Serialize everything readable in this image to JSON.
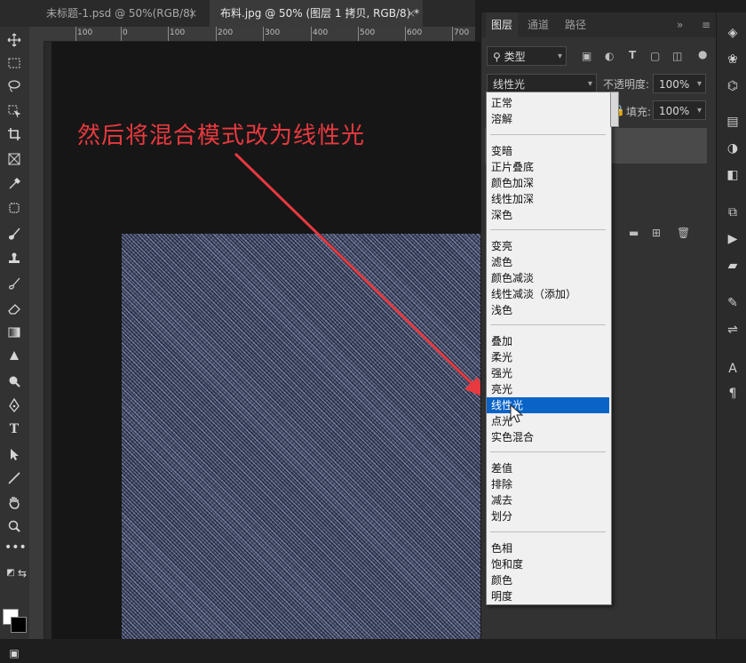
{
  "tabs": [
    {
      "label": "未标题-1.psd @ 50%(RGB/8)",
      "close": "×"
    },
    {
      "label": "布料.jpg @ 50% (图层 1 拷贝, RGB/8) *",
      "close": "×"
    }
  ],
  "ruler": {
    "ticks": [
      "100",
      "0",
      "100",
      "200",
      "300",
      "400",
      "500",
      "600",
      "700"
    ]
  },
  "annotation": "然后将混合模式改为线性光",
  "panel": {
    "tabs": [
      "图层",
      "通道",
      "路径"
    ],
    "filter_kind": "类型",
    "blend_mode": "线性光",
    "opacity_label": "不透明度:",
    "opacity_value": "100%",
    "fill_label": "填充:",
    "fill_value": "100%",
    "collapse": "»",
    "menu": "≡"
  },
  "blend_menu": {
    "groups": [
      [
        "正常",
        "溶解"
      ],
      [
        "变暗",
        "正片叠底",
        "颜色加深",
        "线性加深",
        "深色"
      ],
      [
        "变亮",
        "滤色",
        "颜色减淡",
        "线性减淡（添加）",
        "浅色"
      ],
      [
        "叠加",
        "柔光",
        "强光",
        "亮光",
        "线性光",
        "点光",
        "实色混合"
      ],
      [
        "差值",
        "排除",
        "减去",
        "划分"
      ],
      [
        "色相",
        "饱和度",
        "颜色",
        "明度"
      ]
    ],
    "selected": "线性光"
  },
  "colors": {
    "annotation": "#e8393f",
    "selection": "#0a64c8",
    "fabric": "#4d5570"
  }
}
